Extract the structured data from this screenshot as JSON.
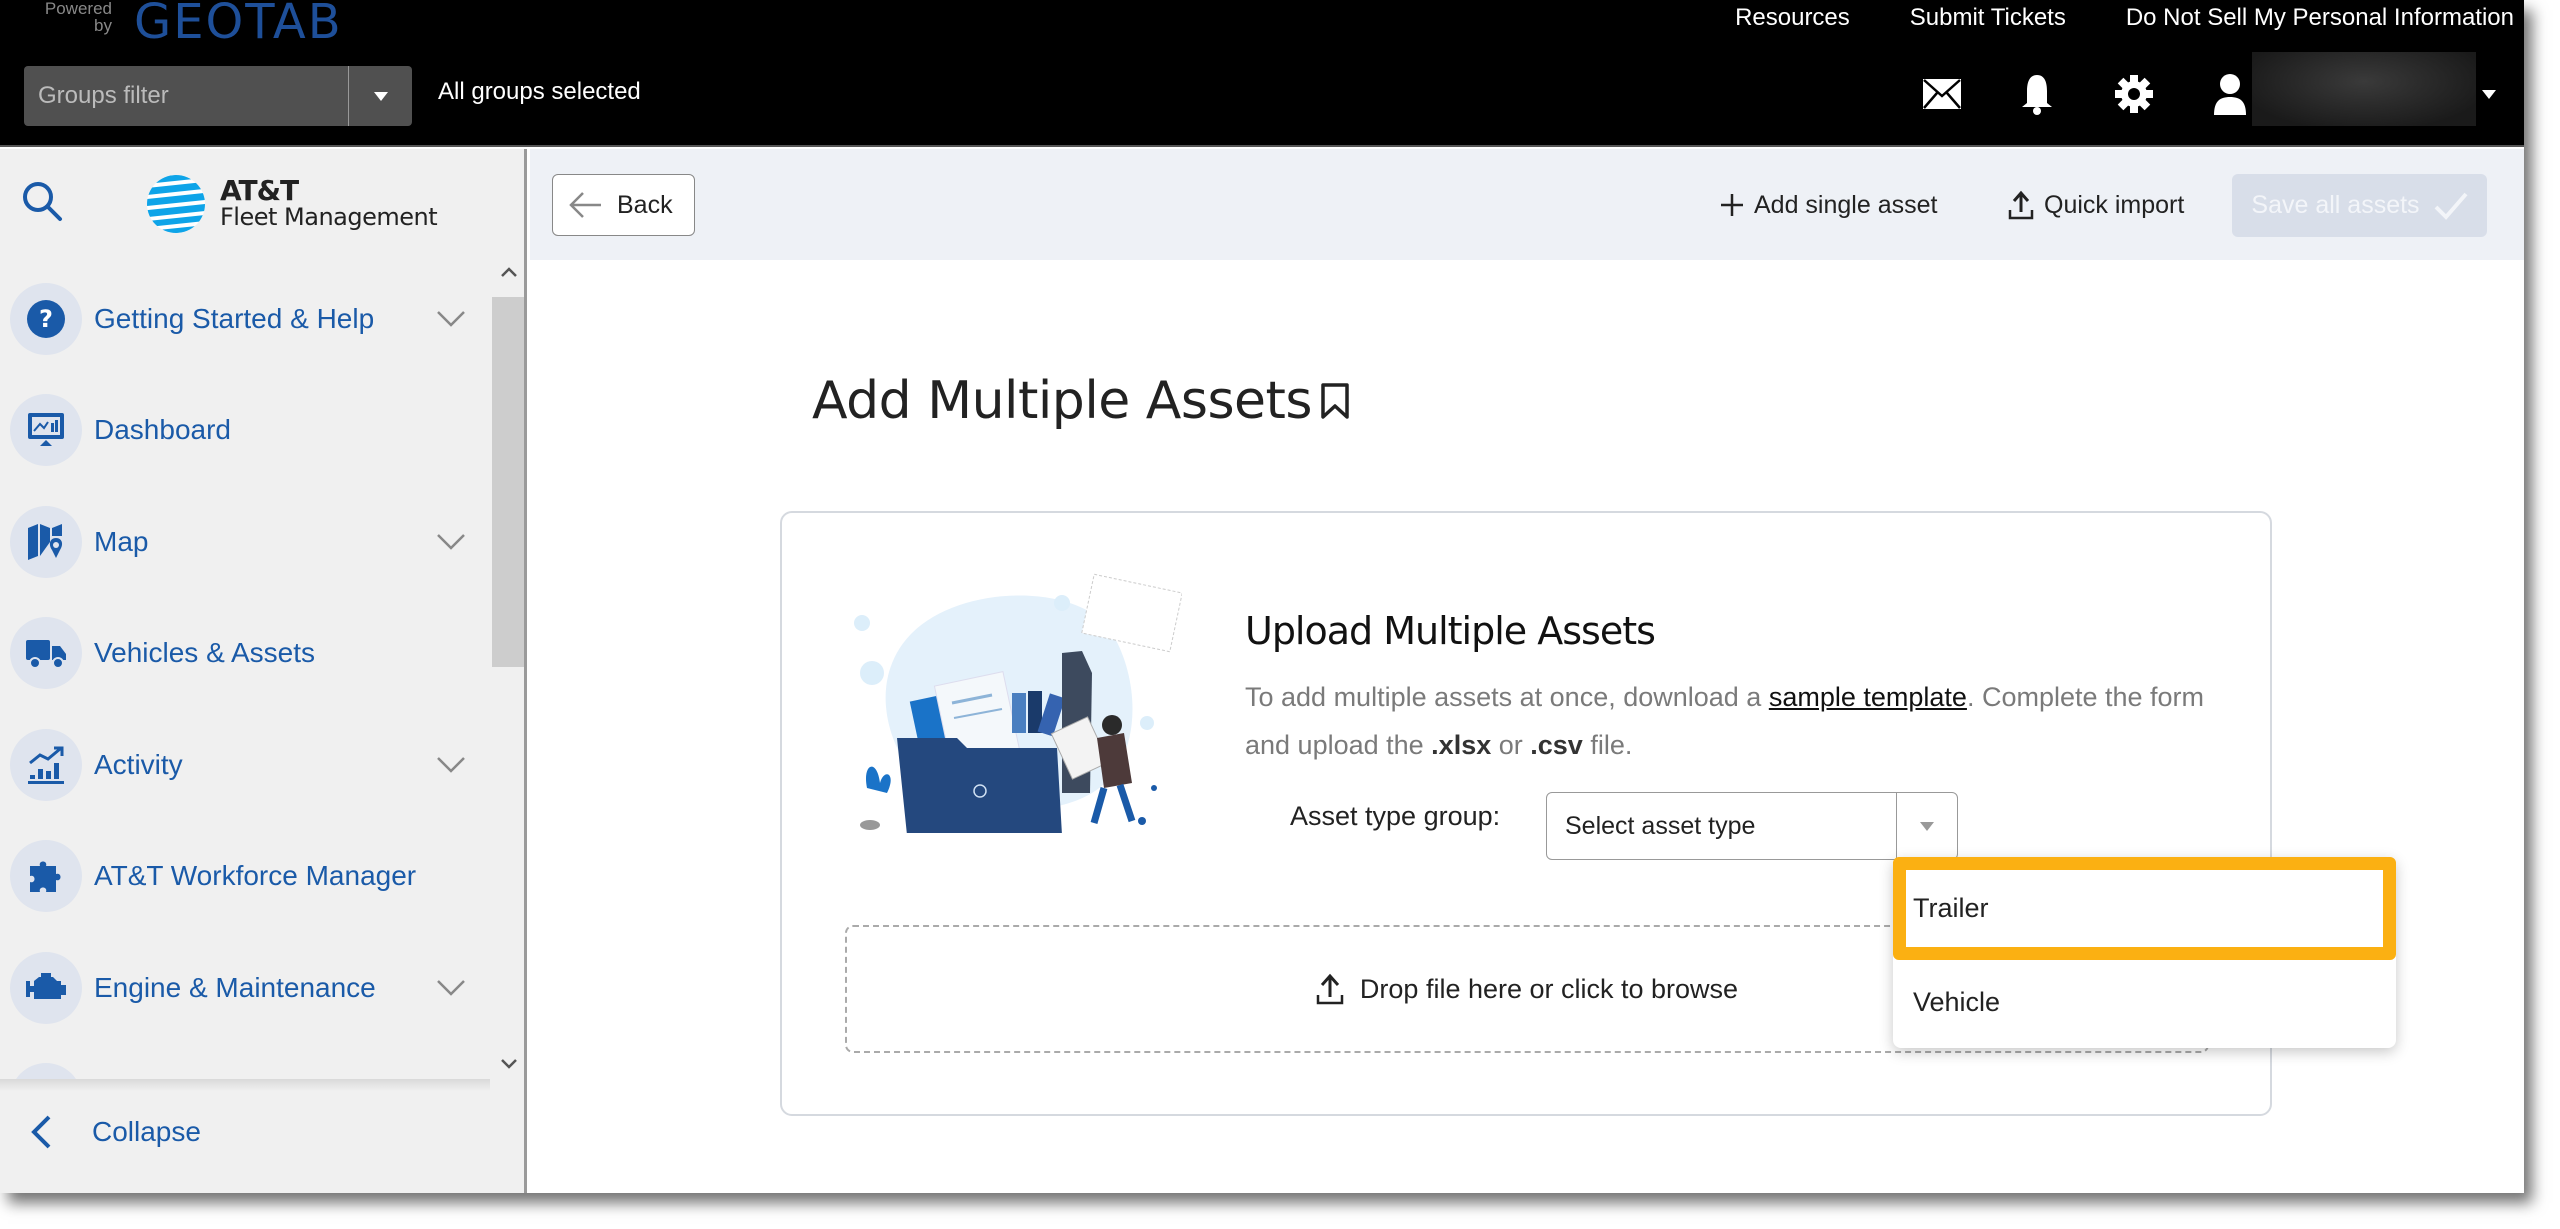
{
  "header": {
    "powered_by": "Powered by",
    "brand": "GEOTAB",
    "links": [
      "Resources",
      "Submit Tickets",
      "Do Not Sell My Personal Information"
    ],
    "groups_filter_placeholder": "Groups filter",
    "groups_status": "All groups selected",
    "icons": [
      "mail-icon",
      "bell-icon",
      "gear-icon",
      "user-icon"
    ]
  },
  "sidebar": {
    "brand_line1": "AT&T",
    "brand_line2": "Fleet Management",
    "items": [
      {
        "label": "Getting Started & Help",
        "icon": "help-icon",
        "expandable": true
      },
      {
        "label": "Dashboard",
        "icon": "dashboard-icon",
        "expandable": false
      },
      {
        "label": "Map",
        "icon": "map-icon",
        "expandable": true
      },
      {
        "label": "Vehicles & Assets",
        "icon": "truck-icon",
        "expandable": false
      },
      {
        "label": "Activity",
        "icon": "activity-chart-icon",
        "expandable": true
      },
      {
        "label": "AT&T Workforce Manager",
        "icon": "puzzle-icon",
        "expandable": false
      },
      {
        "label": "Engine & Maintenance",
        "icon": "engine-icon",
        "expandable": true
      }
    ],
    "collapse_label": "Collapse"
  },
  "toolbar": {
    "back_label": "Back",
    "add_single_label": "Add single asset",
    "quick_import_label": "Quick import",
    "save_all_label": "Save all assets"
  },
  "page": {
    "title": "Add Multiple Assets",
    "upload_title": "Upload Multiple Assets",
    "desc_before": "To add multiple assets at once, download a ",
    "desc_link": "sample template",
    "desc_middle": ". Complete the form and upload the ",
    "desc_ext1": ".xlsx",
    "desc_or": " or ",
    "desc_ext2": ".csv",
    "desc_end": " file.",
    "asset_type_label": "Asset type group:",
    "asset_type_placeholder": "Select asset type",
    "dropzone_label": "Drop file here or click to browse"
  },
  "dropdown": {
    "options": [
      "Trailer",
      "Vehicle"
    ],
    "highlighted": "Trailer",
    "highlight_color": "#fbb012"
  },
  "colors": {
    "accent_blue": "#1a5aa8",
    "header_bg": "#000000"
  }
}
